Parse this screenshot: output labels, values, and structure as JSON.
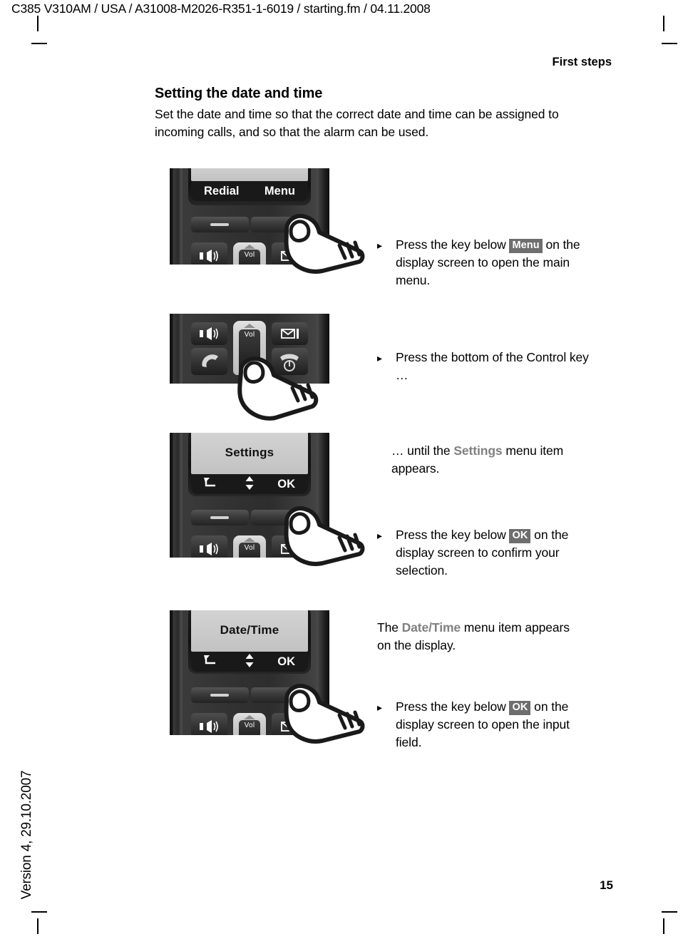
{
  "document": {
    "header_line": "C385 V310AM / USA / A31008-M2026-R351-1-6019 / starting.fm / 04.11.2008",
    "running_head": "First steps",
    "side_version": "Version 4, 29.10.2007",
    "page_number": "15"
  },
  "section": {
    "title": "Setting the date and time",
    "intro": "Set the date and time so that the correct date and time can be assigned to incoming calls, and so that the alarm can be used."
  },
  "steps": [
    {
      "id": "step-menu",
      "phone": {
        "softkeys": {
          "left": "Redial",
          "right": "Menu"
        },
        "keys": {
          "speaker": "speaker-icon",
          "message": "envelope-icon",
          "volume_label": "Vol"
        }
      },
      "instruction": {
        "bullet": "▸",
        "parts": [
          {
            "type": "text",
            "value": "Press the key below "
          },
          {
            "type": "chip",
            "value": "Menu"
          },
          {
            "type": "text",
            "value": " on the display screen to open the main menu."
          }
        ]
      }
    },
    {
      "id": "step-control-key",
      "phone": {
        "keys": {
          "speaker": "speaker-icon",
          "message": "envelope-icon",
          "talk": "handset-pickup-icon",
          "endcall": "handset-hangup-power-icon",
          "volume_label": "Vol"
        }
      },
      "instruction": {
        "bullet": "▸",
        "parts": [
          {
            "type": "text",
            "value": "Press the bottom of the Control key …"
          }
        ]
      }
    },
    {
      "id": "step-settings",
      "phone": {
        "screen_title": "Settings",
        "softkeys": {
          "left": "back-arrow-icon",
          "middle": "up-down-arrows-icon",
          "right": "OK"
        },
        "keys": {
          "speaker": "speaker-icon",
          "message": "envelope-icon",
          "volume_label": "Vol"
        }
      },
      "instruction_note": {
        "parts": [
          {
            "type": "text",
            "value": "… until the "
          },
          {
            "type": "mname",
            "value": "Settings"
          },
          {
            "type": "text",
            "value": " menu item appears."
          }
        ]
      },
      "instruction": {
        "bullet": "▸",
        "parts": [
          {
            "type": "text",
            "value": "Press the key below "
          },
          {
            "type": "chip",
            "value": "OK"
          },
          {
            "type": "text",
            "value": " on the display screen to confirm your selection."
          }
        ]
      }
    },
    {
      "id": "step-datetime",
      "phone": {
        "screen_title": "Date/Time",
        "softkeys": {
          "left": "back-arrow-icon",
          "middle": "up-down-arrows-icon",
          "right": "OK"
        },
        "keys": {
          "speaker": "speaker-icon",
          "message": "envelope-icon",
          "volume_label": "Vol"
        }
      },
      "instruction_note": {
        "parts": [
          {
            "type": "text",
            "value": "The "
          },
          {
            "type": "mname",
            "value": "Date/Time"
          },
          {
            "type": "text",
            "value": " menu item appears on the display."
          }
        ]
      },
      "instruction": {
        "bullet": "▸",
        "parts": [
          {
            "type": "text",
            "value": "Press the key below "
          },
          {
            "type": "chip",
            "value": "OK"
          },
          {
            "type": "text",
            "value": " on the display screen to open the input field."
          }
        ]
      }
    }
  ],
  "colors": {
    "chip_bg": "#6e6e6e",
    "menu_name": "#808080",
    "screen_bg": "#c9c9c9",
    "phone_body": "#2e2e2e",
    "text": "#000000"
  }
}
